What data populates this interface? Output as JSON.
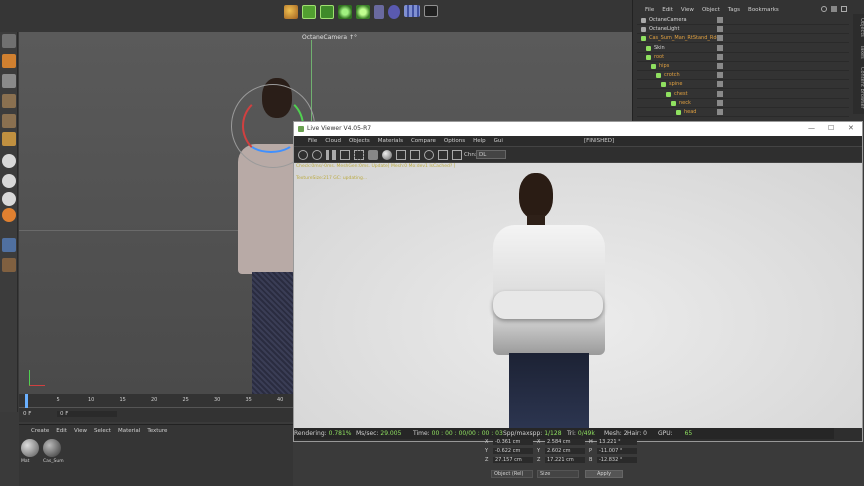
{
  "toolbar_icons": [
    "cube-icon",
    "subdivision-icon",
    "array-icon",
    "mograph-icon",
    "spline-icon",
    "deformer-icon",
    "light-icon",
    "scene-icon",
    "camera-icon"
  ],
  "left_icons": [
    "undo-icon",
    "model-icon",
    "cube-tool-icon",
    "point-icon",
    "edge-icon",
    "polygon-icon",
    "cinema-s-icon",
    "cinema-s2-icon",
    "cinema-s3-icon",
    "octane-icon",
    "render-region-icon",
    "axis-icon"
  ],
  "viewport": {
    "camera_label": "OctaneCamera ↑°"
  },
  "object_manager": {
    "menu": [
      "File",
      "Edit",
      "View",
      "Object",
      "Tags",
      "Bookmarks"
    ],
    "objects": [
      {
        "name": "OctaneCamera",
        "indent": 0,
        "color": "#d8d8d8"
      },
      {
        "name": "OctaneLight",
        "indent": 0,
        "color": "#d8d8d8"
      },
      {
        "name": "Cas_Sum_Man_RtStand_Rd4",
        "indent": 0,
        "color": "#e0a040"
      },
      {
        "name": "Skin",
        "indent": 1,
        "color": "#d8d8d8"
      },
      {
        "name": "root",
        "indent": 1,
        "color": "#e0a040"
      },
      {
        "name": "hips",
        "indent": 2,
        "color": "#e0a040"
      },
      {
        "name": "crotch",
        "indent": 3,
        "color": "#e0a040"
      },
      {
        "name": "spine",
        "indent": 4,
        "color": "#e0a040"
      },
      {
        "name": "chest",
        "indent": 5,
        "color": "#e0a040"
      },
      {
        "name": "neck",
        "indent": 6,
        "color": "#e0a040"
      },
      {
        "name": "head",
        "indent": 7,
        "color": "#e0a040"
      }
    ],
    "side_tabs": [
      "Objects",
      "Takes",
      "Content Browser"
    ]
  },
  "live_viewer": {
    "title": "Live Viewer V4.05-R7",
    "window_controls": [
      "—",
      "☐",
      "✕"
    ],
    "menu": [
      "File",
      "Cloud",
      "Objects",
      "Materials",
      "Compare",
      "Options",
      "Help",
      "Gui"
    ],
    "status": "[FINISHED]",
    "channel_label": "Chn:",
    "channel_value": "DL",
    "info_line1": "Check:0ms/-0ms. MeshGen:0ms. Update[ Mesh:0 Mo:dev1 IsCached? ]",
    "info_line2": "TextureSize:217 GC: updating...",
    "render_status": {
      "rendering_label": "Rendering:",
      "rendering_value": "0.781%",
      "mssec_label": "Ms/sec:",
      "mssec_value": "29.005",
      "time_label": "Time:",
      "time_value": "00 : 00 : 00/00 : 00 : 03",
      "spp_label": "Spp/maxspp:",
      "spp_value": "1/128",
      "tri_label": "Tri:",
      "tri_value": "0/49k",
      "mesh_label": "Mesh:",
      "mesh_value": "2",
      "hair_label": "Hair:",
      "hair_value": "0",
      "gpu_label": "GPU:",
      "gpu_value": "65"
    }
  },
  "timeline": {
    "ticks": [
      "0",
      "5",
      "10",
      "15",
      "20",
      "25",
      "30",
      "35",
      "40"
    ],
    "current_frame": "0 F",
    "start_frame": "0 F"
  },
  "material_manager": {
    "menu": [
      "Create",
      "Edit",
      "View",
      "Select",
      "Material",
      "Texture"
    ],
    "materials": [
      {
        "name": "Mat"
      },
      {
        "name": "Cas_Sum"
      }
    ]
  },
  "coordinates": {
    "rows": [
      {
        "a": "X",
        "a_val": "-0.361 cm",
        "b": "X",
        "b_val": "2.584 cm",
        "c": "H",
        "c_val": "13.221 °"
      },
      {
        "a": "Y",
        "a_val": "-0.622 cm",
        "b": "Y",
        "b_val": "2.602 cm",
        "c": "P",
        "c_val": "-11.007 °"
      },
      {
        "a": "Z",
        "a_val": "27.157 cm",
        "b": "Z",
        "b_val": "17.221 cm",
        "c": "B",
        "c_val": "-12.832 °"
      }
    ],
    "mode": "Object (Rel)",
    "size": "Size",
    "apply": "Apply"
  },
  "colors": {
    "accent_green": "#8fe060",
    "accent_orange": "#e0a040",
    "titlebar_bg": "#ffffff",
    "viewer_bg": "#e2e2e2"
  }
}
